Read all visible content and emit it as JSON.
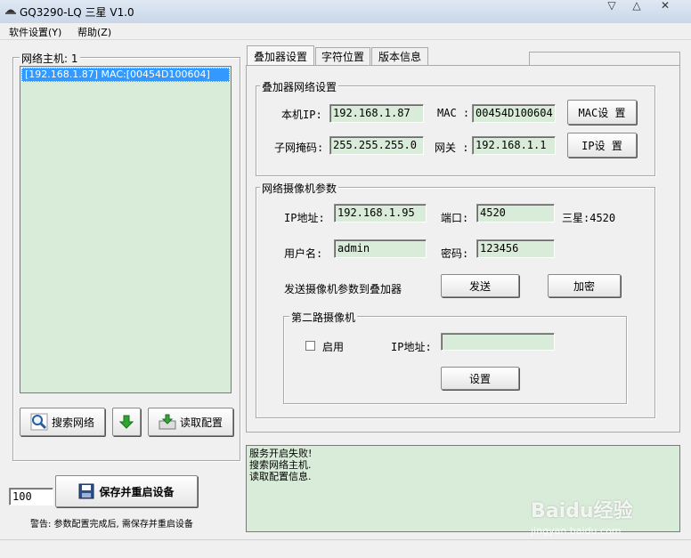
{
  "window": {
    "title": "GQ3290-LQ 三星 V1.0",
    "controls": {
      "minimize": "▽",
      "maximize": "△",
      "close": "✕"
    }
  },
  "menu": [
    "软件设置(Y)",
    "帮助(Z)"
  ],
  "hosts": {
    "title": "网络主机: 1",
    "items": [
      "[192.168.1.87] MAC:[00454D100604]"
    ],
    "search_button": "搜索网络",
    "read_button": "读取配置"
  },
  "save": {
    "value": "100",
    "button": "保存并重启设备",
    "warning": "警告: 参数配置完成后, 需保存并重启设备"
  },
  "tabs": [
    "叠加器设置",
    "字符位置",
    "版本信息"
  ],
  "overlay_network": {
    "title": "叠加器网络设置",
    "ip_label": "本机IP:",
    "ip": "192.168.1.87",
    "mac_label": "MAC :",
    "mac": "00454D100604",
    "mac_button": "MAC设 置",
    "mask_label": "子网掩码:",
    "mask": "255.255.255.0",
    "gw_label": "网关 :",
    "gw": "192.168.1.1",
    "ip_button": "IP设 置"
  },
  "camera": {
    "title": "网络摄像机参数",
    "ip_label": "IP地址:",
    "ip": "192.168.1.95",
    "port_label": "端口:",
    "port": "4520",
    "port_note": "三星:4520",
    "user_label": "用户名:",
    "user": "admin",
    "pwd_label": "密码:",
    "pwd": "123456",
    "send_label": "发送摄像机参数到叠加器",
    "send_button": "发送",
    "encrypt_button": "加密"
  },
  "second_camera": {
    "title": "第二路摄像机",
    "enable_label": "启用",
    "ip_label": "IP地址:",
    "ip": "",
    "set_button": "设置"
  },
  "log": {
    "lines": [
      "服务开启失败!",
      "搜索网络主机.",
      "读取配置信息."
    ]
  },
  "watermark": {
    "brand": "Baidu经验",
    "url": "jingyan.baidu.com"
  }
}
